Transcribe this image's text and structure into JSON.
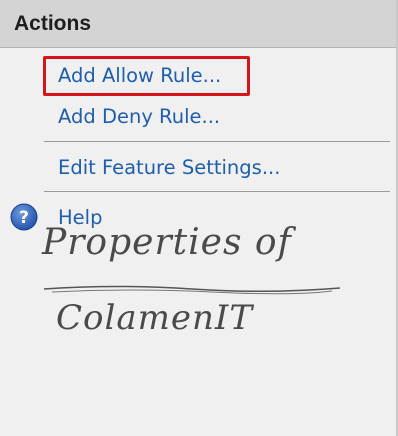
{
  "panel": {
    "title": "Actions"
  },
  "actions": {
    "add_allow_rule": "Add Allow Rule...",
    "add_deny_rule": "Add Deny Rule...",
    "edit_feature_settings": "Edit Feature Settings...",
    "help": "Help"
  },
  "icons": {
    "help": "question-circle-icon"
  },
  "watermark": {
    "line1": "Properties of",
    "line2": "ColamenIT"
  },
  "colors": {
    "link": "#1f5eaa",
    "highlight": "#d7141a",
    "header_bg": "#d4d4d4",
    "panel_bg": "#f0f0f0"
  }
}
